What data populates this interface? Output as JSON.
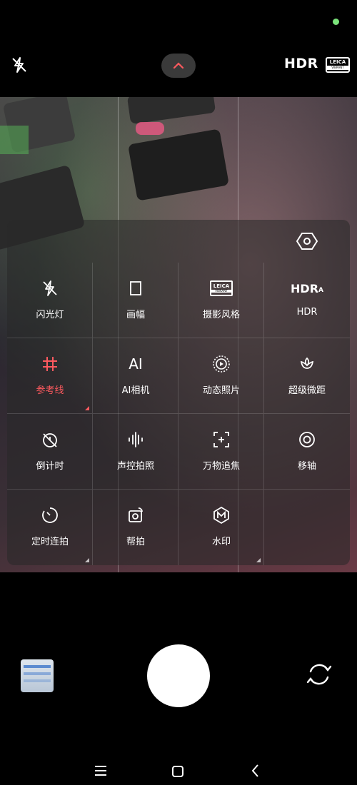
{
  "statusbar": {
    "dot_color": "#7be37b"
  },
  "topbar": {
    "flash_icon": "flash-off-icon",
    "expand_icon": "chevron-up-icon",
    "hdr_label": "HDR",
    "leica_brand": "LEICA",
    "leica_sub": "VIBRANT"
  },
  "panel": {
    "gear_icon": "settings-hexagon-icon",
    "items": [
      {
        "label": "闪光灯",
        "icon": "flash-off-icon",
        "active": false
      },
      {
        "label": "画幅",
        "icon": "aspect-ratio-icon",
        "active": false
      },
      {
        "label": "摄影风格",
        "icon": "leica-style-icon",
        "active": false,
        "badge_brand": "LEICA",
        "badge_sub": "VIBRANT"
      },
      {
        "label": "HDR",
        "icon": "hdr-auto-icon",
        "active": false,
        "icon_text": "HDR",
        "icon_sub": "A"
      },
      {
        "label": "参考线",
        "icon": "grid-icon",
        "active": true
      },
      {
        "label": "AI相机",
        "icon": "ai-icon",
        "active": false,
        "icon_text": "AI"
      },
      {
        "label": "动态照片",
        "icon": "live-photo-icon",
        "active": false
      },
      {
        "label": "超级微距",
        "icon": "macro-flower-icon",
        "active": false
      },
      {
        "label": "倒计时",
        "icon": "timer-off-icon",
        "active": false
      },
      {
        "label": "声控拍照",
        "icon": "voice-wave-icon",
        "active": false
      },
      {
        "label": "万物追焦",
        "icon": "focus-track-icon",
        "active": false
      },
      {
        "label": "移轴",
        "icon": "tilt-shift-icon",
        "active": false
      },
      {
        "label": "定时连拍",
        "icon": "interval-timer-icon",
        "active": false
      },
      {
        "label": "帮拍",
        "icon": "remote-shoot-icon",
        "active": false
      },
      {
        "label": "水印",
        "icon": "watermark-icon",
        "active": false
      }
    ],
    "accent_color": "#ff5a5f"
  },
  "bottom": {
    "gallery_icon": "gallery-thumbnail",
    "shutter_icon": "shutter-button",
    "switch_icon": "switch-camera-icon"
  },
  "navbar": {
    "menu_icon": "menu-icon",
    "home_icon": "home-icon",
    "back_icon": "back-icon"
  }
}
